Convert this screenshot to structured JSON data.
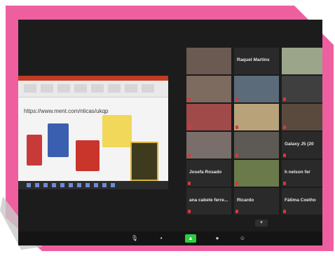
{
  "shared_screen": {
    "url": "https://www.ment.com/nlicas/ukqp"
  },
  "participants": [
    {
      "name": "",
      "type": "video"
    },
    {
      "name": "Raquel Martins",
      "type": "name"
    },
    {
      "name": "",
      "type": "video"
    },
    {
      "name": "",
      "type": "video"
    },
    {
      "name": "",
      "type": "video"
    },
    {
      "name": "",
      "type": "video"
    },
    {
      "name": "",
      "type": "video"
    },
    {
      "name": "",
      "type": "video"
    },
    {
      "name": "",
      "type": "video"
    },
    {
      "name": "",
      "type": "video"
    },
    {
      "name": "",
      "type": "video"
    },
    {
      "name": "Galaxy J5 (20",
      "type": "name"
    },
    {
      "name": "Josefa Rosado",
      "type": "name"
    },
    {
      "name": "",
      "type": "video"
    },
    {
      "name": "h nelson fer",
      "type": "name"
    },
    {
      "name": "ana cabete ferre...",
      "type": "name"
    },
    {
      "name": "Ricardo",
      "type": "name"
    },
    {
      "name": "Fátima Coelho",
      "type": "name"
    }
  ],
  "icons": [
    "chevron-down-icon",
    "mic-icon",
    "chat-icon",
    "share-icon",
    "record-icon",
    "reactions-icon"
  ],
  "colors": {
    "frame": "#ee5fa0",
    "screen": "#1c1c1c",
    "share": "#2ecc40"
  }
}
